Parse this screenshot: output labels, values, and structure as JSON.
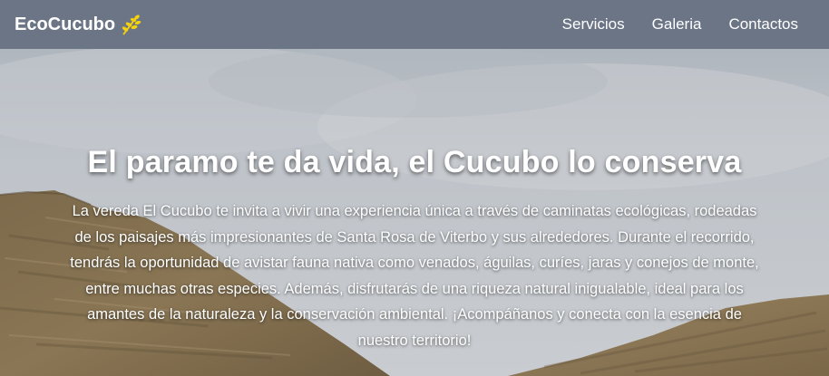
{
  "navbar": {
    "brand": "EcoCucubo",
    "brand_icon": "leaf-sprig-icon",
    "brand_icon_color": "#f5d20a",
    "background": "#6b7586",
    "links": [
      "Servicios",
      "Galeria",
      "Contactos"
    ]
  },
  "hero": {
    "title": "El paramo te da vida, el Cucubo lo conserva",
    "paragraph": "La vereda El Cucubo te invita a vivir una experiencia única a través de caminatas ecológicas, rodeadas de los paisajes más impresionantes de Santa Rosa de Viterbo y sus alrededores. Durante el recorrido, tendrás la oportunidad de avistar fauna nativa como venados, águilas, curíes, jaras y conejos de monte, entre muchas otras especies. Además, disfrutarás de una riqueza natural inigualable, ideal para los amantes de la naturaleza y la conservación ambiental. ¡Acompáñanos y conecta con la esencia de nuestro territorio!",
    "background_image": "cloudy paramo hillside"
  }
}
